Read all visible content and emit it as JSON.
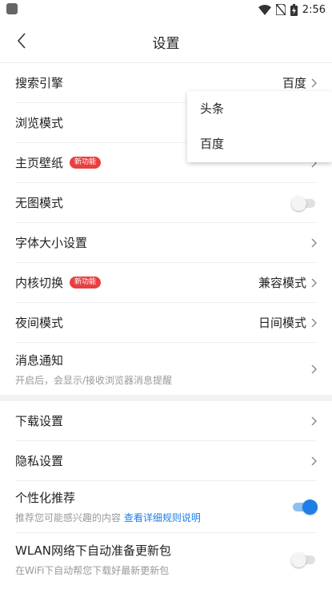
{
  "status_bar": {
    "time": "2:56"
  },
  "header": {
    "title": "设置"
  },
  "settings_group1": [
    {
      "label": "搜索引擎",
      "value": "百度"
    },
    {
      "label": "浏览模式"
    },
    {
      "label": "主页壁纸",
      "badge": "新功能"
    },
    {
      "label": "无图模式",
      "toggle": false
    },
    {
      "label": "字体大小设置"
    },
    {
      "label": "内核切换",
      "badge": "新功能",
      "value": "兼容模式"
    },
    {
      "label": "夜间模式",
      "value": "日间模式"
    },
    {
      "label": "消息通知",
      "sub": "开启后，会显示/接收浏览器消息提醒"
    }
  ],
  "settings_group2": [
    {
      "label": "下载设置"
    },
    {
      "label": "隐私设置"
    },
    {
      "label": "个性化推荐",
      "sub": "推荐您可能感兴趣的内容",
      "sub_link": "查看详细规则说明",
      "toggle": true
    },
    {
      "label": "WLAN网络下自动准备更新包",
      "sub": "在WiFi下自动帮您下载好最新更新包",
      "toggle": false
    }
  ],
  "dropdown": {
    "items": [
      "头条",
      "百度"
    ]
  },
  "colors": {
    "accent": "#1d7ee6",
    "badge": "#e84040"
  }
}
